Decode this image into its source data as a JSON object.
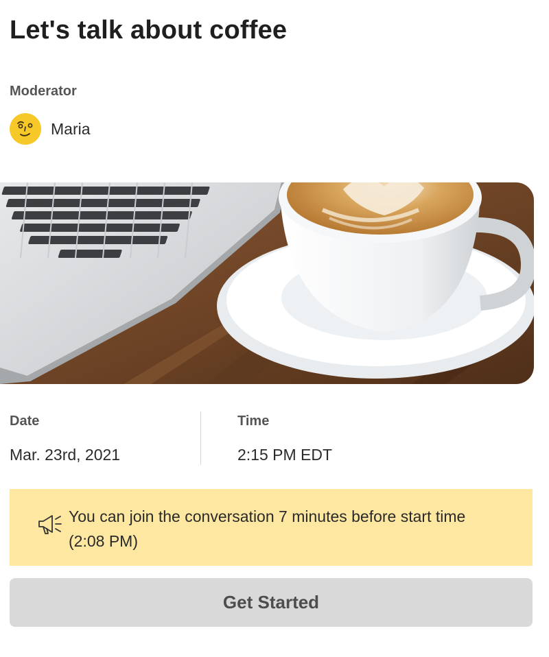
{
  "event": {
    "title": "Let's talk about coffee"
  },
  "moderator": {
    "label": "Moderator",
    "name": "Maria",
    "avatar_icon": "smirk-face-avatar-icon",
    "avatar_color": "#f7c928"
  },
  "hero_image": {
    "subject": "laptop-and-latte-photo"
  },
  "schedule": {
    "date_label": "Date",
    "date_value": "Mar. 23rd, 2021",
    "time_label": "Time",
    "time_value": "2:15 PM EDT"
  },
  "notice": {
    "icon": "megaphone-icon",
    "text": "You can join the conversation 7 minutes before start time (2:08 PM)",
    "background": "#fde7a1"
  },
  "actions": {
    "get_started_label": "Get Started",
    "get_started_background": "#d9d9d9"
  }
}
